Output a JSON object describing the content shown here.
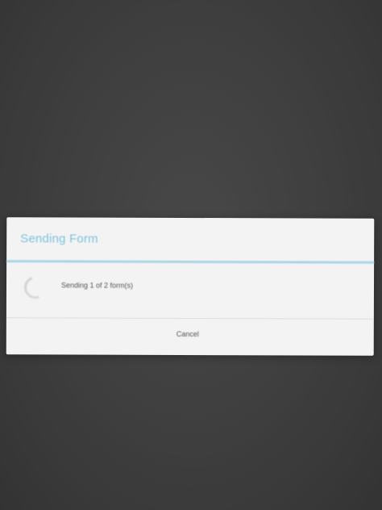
{
  "dialog": {
    "title": "Sending Form",
    "message": "Sending 1 of 2 form(s)",
    "cancel_label": "Cancel"
  },
  "icons": {
    "progress": "spinner-icon"
  },
  "colors": {
    "background": "#474747",
    "dialog_background": "#f3f3f3",
    "title": "#7cc3de",
    "title_divider": "#a9d5e7",
    "text": "#555555"
  }
}
